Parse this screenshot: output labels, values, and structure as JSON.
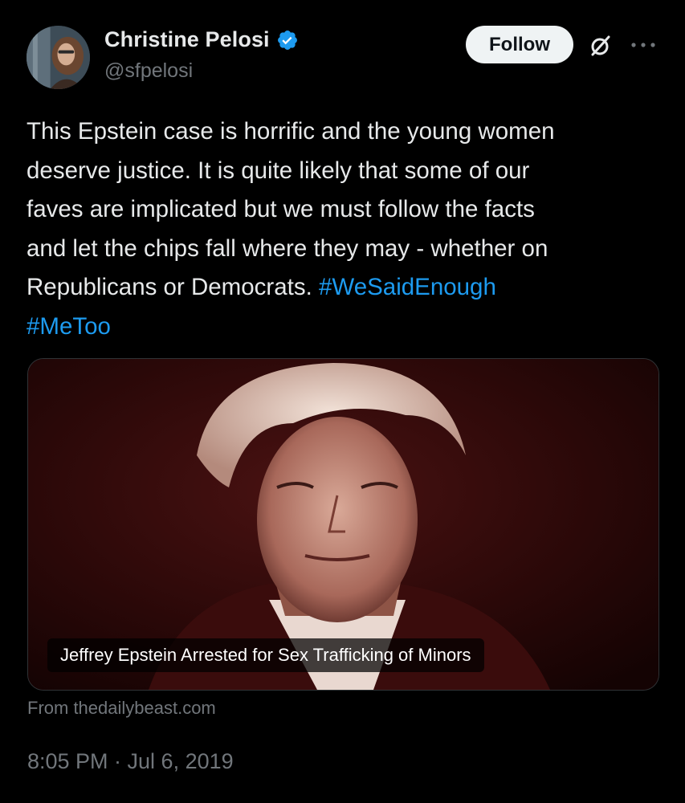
{
  "author": {
    "display_name": "Christine Pelosi",
    "handle": "@sfpelosi",
    "verified": true
  },
  "actions": {
    "follow_label": "Follow"
  },
  "icons": {
    "verified": "verified-badge-icon",
    "grok": "grok-icon",
    "more": "more-options-icon"
  },
  "tweet": {
    "lines": [
      "This Epstein case is horrific and the young women",
      "deserve justice. It is quite likely that some of our",
      "faves are implicated but we must follow the facts",
      "and let the chips fall where they may - whether on"
    ],
    "last_line_text": "Republicans or Democrats. ",
    "hashtag_1": "#WeSaidEnough",
    "hashtag_2": "#MeToo"
  },
  "card": {
    "title": "Jeffrey Epstein Arrested for Sex Trafficking of Minors",
    "source": "From thedailybeast.com"
  },
  "meta": {
    "timestamp": "8:05 PM · Jul 6, 2019"
  },
  "colors": {
    "background": "#000000",
    "text": "#e7e9ea",
    "secondary_text": "#71767b",
    "link": "#1d9bf0",
    "verified": "#1d9bf0",
    "follow_button_bg": "#eff3f4"
  }
}
